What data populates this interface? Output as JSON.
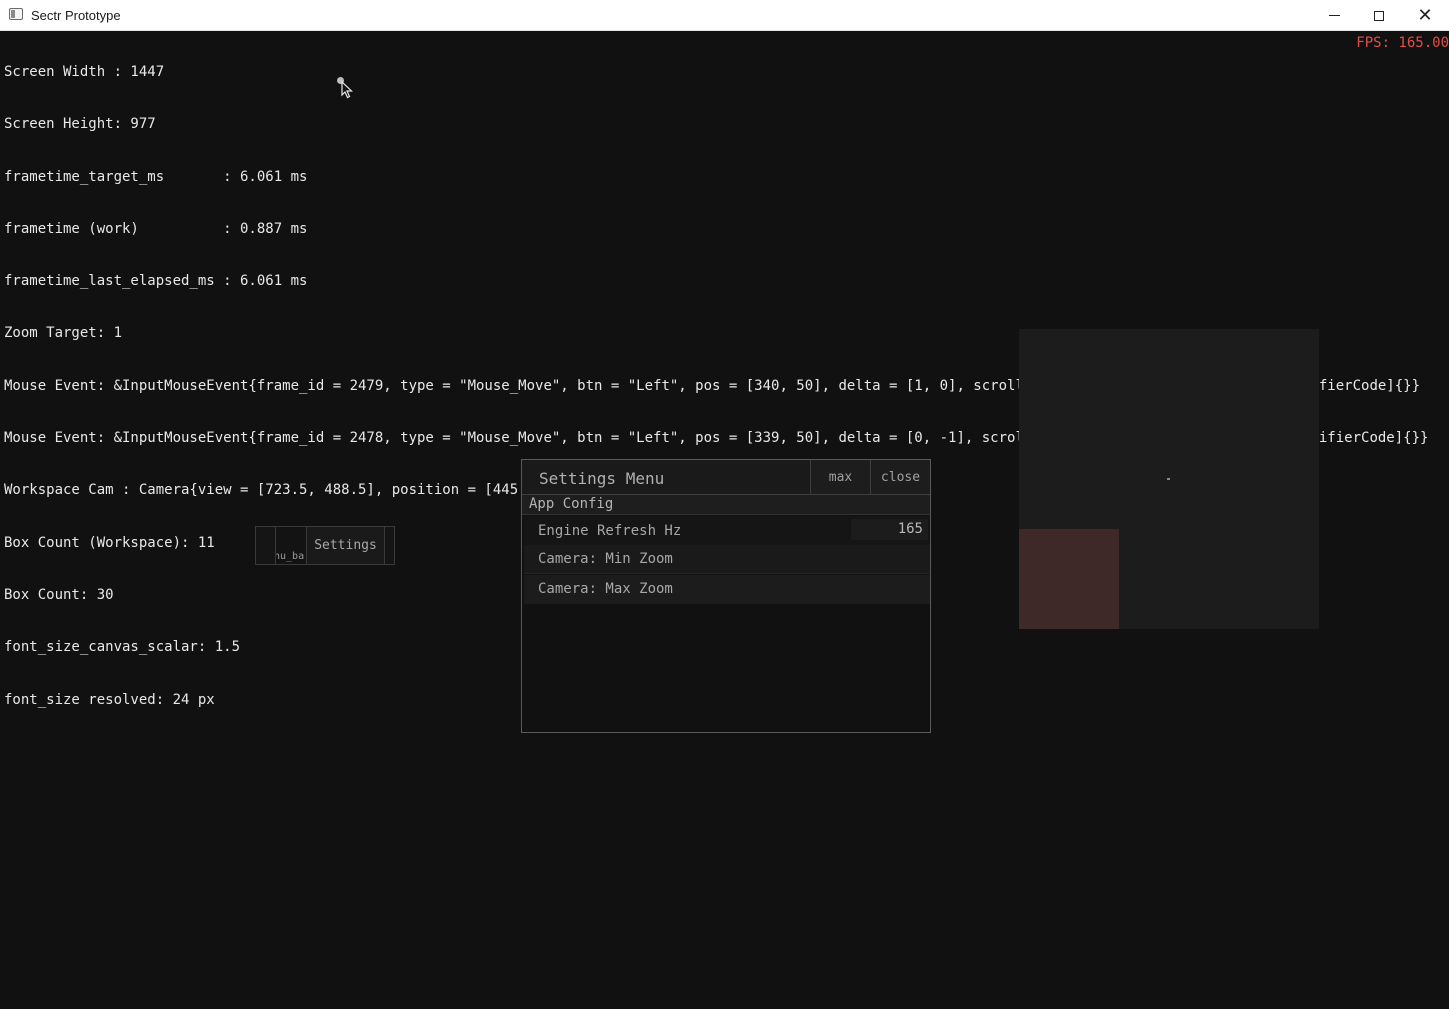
{
  "window": {
    "title": "Sectr Prototype",
    "minimize_glyph": "minimize-icon",
    "maximize_glyph": "maximize-icon",
    "close_glyph": "✕"
  },
  "debug": {
    "lines": [
      "Screen Width : 1447",
      "Screen Height: 977",
      "frametime_target_ms       : 6.061 ms",
      "frametime (work)          : 0.887 ms",
      "frametime_last_elapsed_ms : 6.061 ms",
      "Zoom Target: 1",
      "Mouse Event: &InputMouseEvent{frame_id = 2479, type = \"Mouse_Move\", btn = \"Left\", pos = [340, 50], delta = [1, 0], scroll = [0, 0], modifiers = bit_set[ModifierCode]{}}",
      "Mouse Event: &InputMouseEvent{frame_id = 2478, type = \"Mouse_Move\", btn = \"Left\", pos = [339, 50], delta = [0, -1], scroll = [0, 0], modifiers = bit_set[ModifierCode]{}}",
      "Workspace Cam : Camera{view = [723.5, 488.5], position = [445, 40], zoom = 1}",
      "Box Count (Workspace): 11",
      "Box Count: 30",
      "font_size_canvas_scalar: 1.5",
      "font_size resolved: 24 px"
    ],
    "fps": "FPS: 165.00"
  },
  "menu_bar": {
    "label_fragment": "nu_ba",
    "settings_button": "Settings"
  },
  "settings_menu": {
    "title": "Settings Menu",
    "max_label": "max",
    "close_label": "close",
    "section": "App Config",
    "rows": [
      {
        "label": "Engine Refresh Hz",
        "value": "165"
      },
      {
        "label": "Camera: Min Zoom"
      },
      {
        "label": "Camera: Max Zoom"
      }
    ]
  },
  "colors": {
    "background": "#111111",
    "fps_text": "#e0504a",
    "red_box": "#3f2828"
  }
}
